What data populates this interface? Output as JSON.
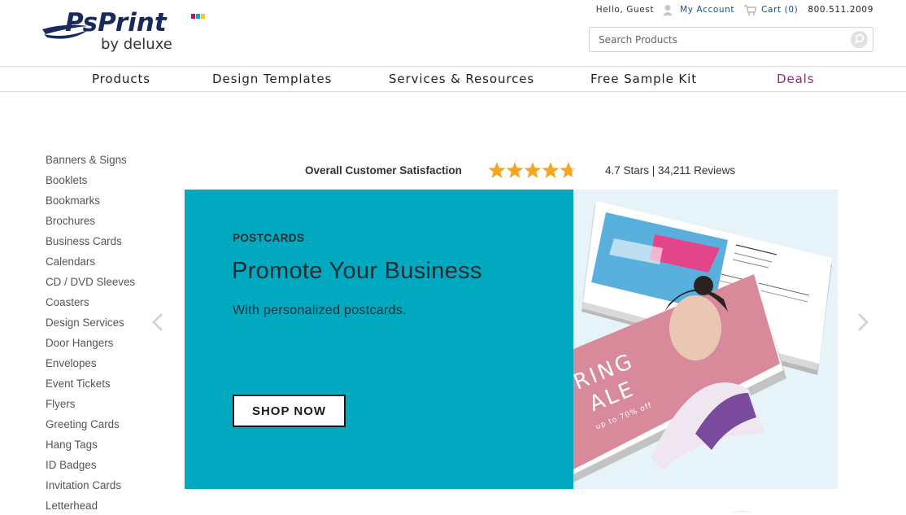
{
  "brand": {
    "name": "PsPrint",
    "tagline": "by deluxe"
  },
  "utility": {
    "greeting": "Hello, Guest",
    "my_account": "My Account",
    "cart": "Cart (0)",
    "phone": "800.511.2009"
  },
  "search": {
    "placeholder": "Search Products",
    "value": ""
  },
  "nav": {
    "items": [
      {
        "label": "Products"
      },
      {
        "label": "Design Templates"
      },
      {
        "label": "Services & Resources"
      },
      {
        "label": "Free Sample Kit"
      },
      {
        "label": "Deals"
      }
    ]
  },
  "sidebar": {
    "items": [
      {
        "label": "Banners & Signs"
      },
      {
        "label": "Booklets"
      },
      {
        "label": "Bookmarks"
      },
      {
        "label": "Brochures"
      },
      {
        "label": "Business Cards"
      },
      {
        "label": "Calendars"
      },
      {
        "label": "CD / DVD Sleeves"
      },
      {
        "label": "Coasters"
      },
      {
        "label": "Design Services"
      },
      {
        "label": "Door Hangers"
      },
      {
        "label": "Envelopes"
      },
      {
        "label": "Event Tickets"
      },
      {
        "label": "Flyers"
      },
      {
        "label": "Greeting Cards"
      },
      {
        "label": "Hang Tags"
      },
      {
        "label": "ID Badges"
      },
      {
        "label": "Invitation Cards"
      },
      {
        "label": "Letterhead"
      }
    ]
  },
  "rating": {
    "label": "Overall Customer Satisfaction",
    "stars": 4.7,
    "summary": "4.7 Stars | 34,211 Reviews"
  },
  "carousel": {
    "eyebrow": "POSTCARDS",
    "title": "Promote Your Business",
    "subtitle": "With personalized postcards.",
    "cta": "SHOP NOW",
    "image_text": {
      "line1": "RING",
      "line2": "ALE",
      "small": "up to 70% off"
    }
  },
  "colors": {
    "accent_teal": "#00a9bf",
    "deals": "#a0246e",
    "link_blue": "#1a4d8f",
    "star": "#f5a623"
  }
}
